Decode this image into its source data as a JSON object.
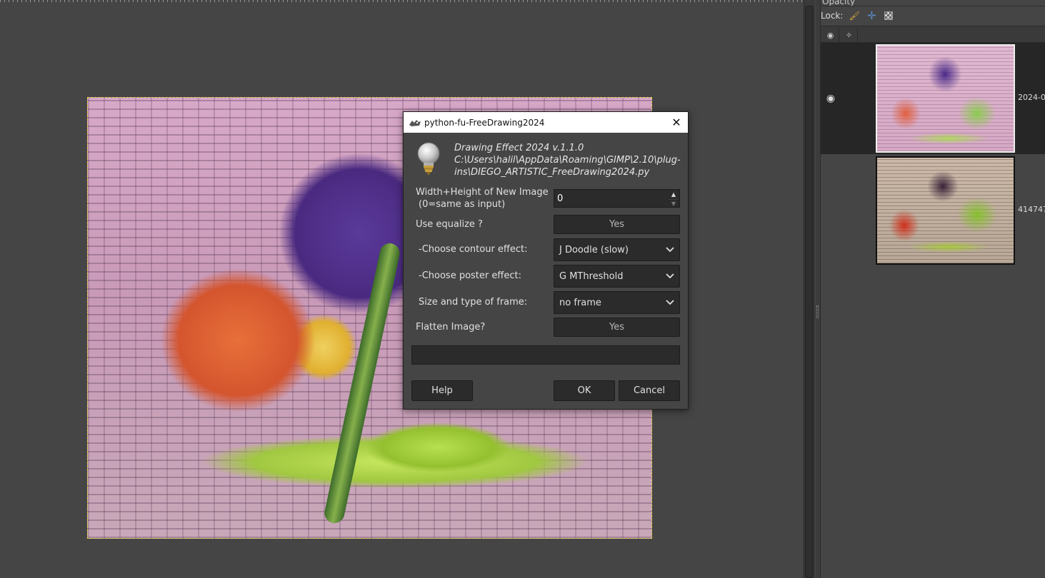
{
  "panel": {
    "opacity_label": "Opacity",
    "lock_label": "Lock:",
    "layers": [
      {
        "name": "2024-0"
      },
      {
        "name": "414747"
      }
    ]
  },
  "dialog": {
    "title": "python-fu-FreeDrawing2024",
    "description_line1": "Drawing Effect 2024 v.1.1.0",
    "description_line2": "C:\\Users\\halil\\AppData\\Roaming\\GIMP\\2.10\\plug-",
    "description_line3": "ins\\DIEGO_ARTISTIC_FreeDrawing2024.py",
    "size_label_line1": "Width+Height of New Image",
    "size_label_line2": "(0=same as input)",
    "size_value": "0",
    "equalize_label": "Use equalize ?",
    "equalize_value": "Yes",
    "contour_label": "-Choose contour effect:",
    "contour_value": "J Doodle (slow)",
    "poster_label": "-Choose poster effect:",
    "poster_value": "G MThreshold",
    "frame_label": "Size and type of frame:",
    "frame_value": "no frame",
    "flatten_label": "Flatten Image?",
    "flatten_value": "Yes",
    "help_label": "Help",
    "ok_label": "OK",
    "cancel_label": "Cancel"
  },
  "icons": {
    "close": "close-icon",
    "app": "gimp-wilber-icon",
    "bulb": "lightbulb-icon",
    "eye": "eye-icon",
    "chain": "chain-icon",
    "lock_pixels": "paintbrush-icon",
    "lock_position": "move-icon",
    "lock_alpha": "checkerboard-icon"
  }
}
